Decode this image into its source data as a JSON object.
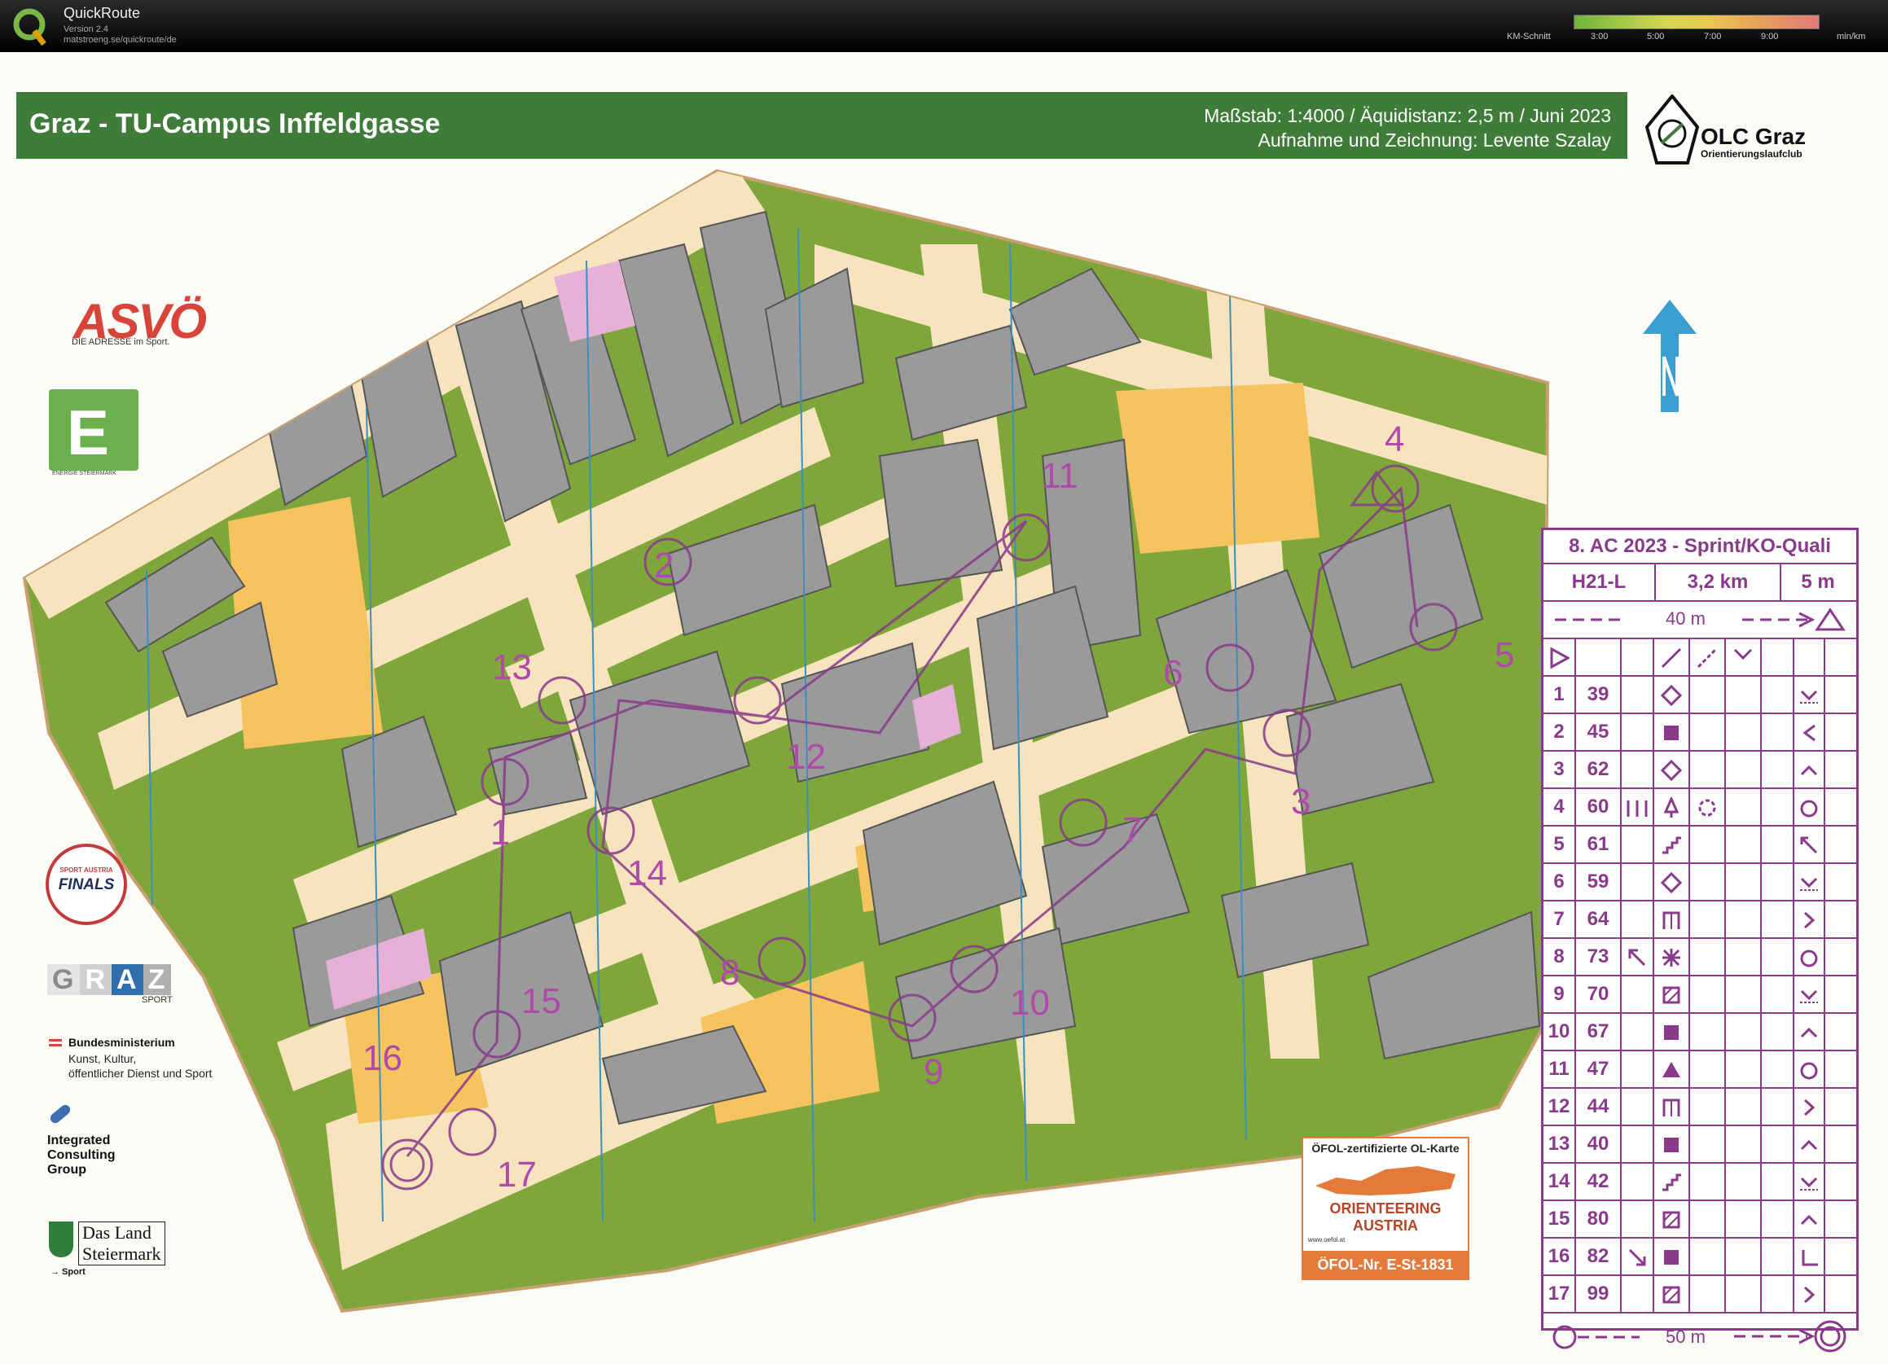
{
  "app": {
    "title": "QuickRoute",
    "version": "Version 2.4",
    "url": "matstroeng.se/quickroute/de",
    "km_label": "KM-Schnitt",
    "pace_ticks": [
      "3:00",
      "5:00",
      "7:00",
      "9:00"
    ],
    "pace_unit": "min/km"
  },
  "map": {
    "title": "Graz - TU-Campus Inffeldgasse",
    "scale_line": "Maßstab: 1:4000 / Äquidistanz: 2,5 m / Juni 2023",
    "author_line": "Aufnahme und Zeichnung: Levente Szalay",
    "club_name": "OLC Graz",
    "club_sub": "Orientierungslaufclub",
    "north_icon": "north-arrow-icon",
    "control_numbers": [
      "1",
      "2",
      "3",
      "4",
      "5",
      "6",
      "7",
      "8",
      "9",
      "10",
      "11",
      "12",
      "13",
      "14",
      "15",
      "16",
      "17"
    ],
    "colors": {
      "course": "#8a3a8a",
      "forest": "#7fa63a",
      "open": "#f5c45e",
      "building": "#9a9a9a",
      "paved": "#f7e4bf"
    }
  },
  "sponsors": {
    "asvo": "ASVÖ",
    "asvo_sub": "DIE ADRESSE im Sport.",
    "energie_letter": "E",
    "energie_sub": "ENERGIE STEIERMARK",
    "finals_top": "SPORT AUSTRIA",
    "finals": "FINALS",
    "graz_letters": [
      "G",
      "R",
      "A",
      "Z"
    ],
    "graz_sub": "SPORT",
    "bund_title": "Bundesministerium",
    "bund_lines": [
      "Kunst, Kultur,",
      "öffentlicher Dienst und Sport"
    ],
    "icg_lines": [
      "Integrated",
      "Consulting",
      "Group"
    ],
    "land_lines": [
      "Das Land",
      "Steiermark"
    ],
    "land_sub": "→ Sport"
  },
  "oefol": {
    "top": "ÖFOL-zertifizierte OL-Karte",
    "middle": "ORIENTEERING AUSTRIA",
    "url": "www.oefol.at",
    "number": "ÖFOL-Nr. E-St-1831"
  },
  "description_sheet": {
    "title": "8. AC 2023 - Sprint/KO-Quali",
    "category": "H21-L",
    "distance": "3,2 km",
    "climb": "5 m",
    "start_marking": "40 m",
    "finish": "50 m",
    "controls": [
      {
        "num": "1",
        "code": "39",
        "feature": "diamond-icon",
        "position": "south-icon"
      },
      {
        "num": "2",
        "code": "45",
        "feature": "filled-square-icon",
        "position": "west-corner-icon"
      },
      {
        "num": "3",
        "code": "62",
        "feature": "diamond-icon",
        "position": "north-icon"
      },
      {
        "num": "4",
        "code": "60",
        "feature": "tree-icon",
        "position": "part-icon"
      },
      {
        "num": "5",
        "code": "61",
        "feature": "stairs-icon",
        "position": "north-west-icon"
      },
      {
        "num": "6",
        "code": "59",
        "feature": "diamond-icon",
        "position": "south-icon"
      },
      {
        "num": "7",
        "code": "64",
        "feature": "gate-icon",
        "position": "east-icon"
      },
      {
        "num": "8",
        "code": "73",
        "feature": "special-icon",
        "position": "part-icon"
      },
      {
        "num": "9",
        "code": "70",
        "feature": "hatched-square-icon",
        "position": "south-icon"
      },
      {
        "num": "10",
        "code": "67",
        "feature": "filled-square-icon",
        "position": "north-icon"
      },
      {
        "num": "11",
        "code": "47",
        "feature": "triangle-icon",
        "position": "part-icon"
      },
      {
        "num": "12",
        "code": "44",
        "feature": "gate-icon",
        "position": "east-icon"
      },
      {
        "num": "13",
        "code": "40",
        "feature": "filled-square-icon",
        "position": "north-icon"
      },
      {
        "num": "14",
        "code": "42",
        "feature": "stairs-icon",
        "position": "south-icon"
      },
      {
        "num": "15",
        "code": "80",
        "feature": "hatched-square-icon",
        "position": "north-icon"
      },
      {
        "num": "16",
        "code": "82",
        "feature": "filled-square-icon",
        "position": "south-west-icon"
      },
      {
        "num": "17",
        "code": "99",
        "feature": "hatched-square-icon",
        "position": "east-icon"
      }
    ]
  }
}
